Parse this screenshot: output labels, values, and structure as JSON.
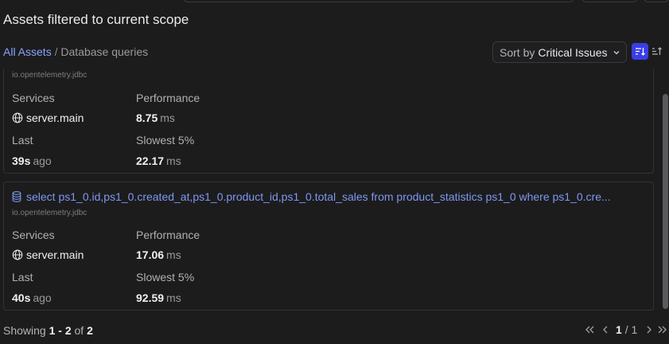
{
  "heading": "Assets filtered to current scope",
  "breadcrumb": {
    "root": "All Assets",
    "separator": "/",
    "current": "Database queries"
  },
  "sort": {
    "prefix": "Sort by",
    "value": "Critical Issues"
  },
  "colors": {
    "accent": "#3a3ee6",
    "link": "#8aa2ff",
    "title_link": "#7f97f0"
  },
  "cards": [
    {
      "library": "io.opentelemetry.jdbc",
      "services_label": "Services",
      "service": "server.main",
      "performance_label": "Performance",
      "performance_value": "8.75",
      "performance_unit": "ms",
      "last_label": "Last",
      "last_value": "39s",
      "last_suffix": "ago",
      "slowest_label": "Slowest 5%",
      "slowest_value": "22.17",
      "slowest_unit": "ms"
    },
    {
      "title": "select ps1_0.id,ps1_0.created_at,ps1_0.product_id,ps1_0.total_sales from product_statistics ps1_0 where ps1_0.cre...",
      "icon": "database-icon",
      "library": "io.opentelemetry.jdbc",
      "services_label": "Services",
      "service": "server.main",
      "performance_label": "Performance",
      "performance_value": "17.06",
      "performance_unit": "ms",
      "last_label": "Last",
      "last_value": "40s",
      "last_suffix": "ago",
      "slowest_label": "Slowest 5%",
      "slowest_value": "92.59",
      "slowest_unit": "ms"
    }
  ],
  "footer": {
    "showing_prefix": "Showing",
    "range": "1 - 2",
    "of_word": "of",
    "total": "2"
  },
  "pager": {
    "current": "1",
    "separator": "/",
    "total": "1"
  }
}
